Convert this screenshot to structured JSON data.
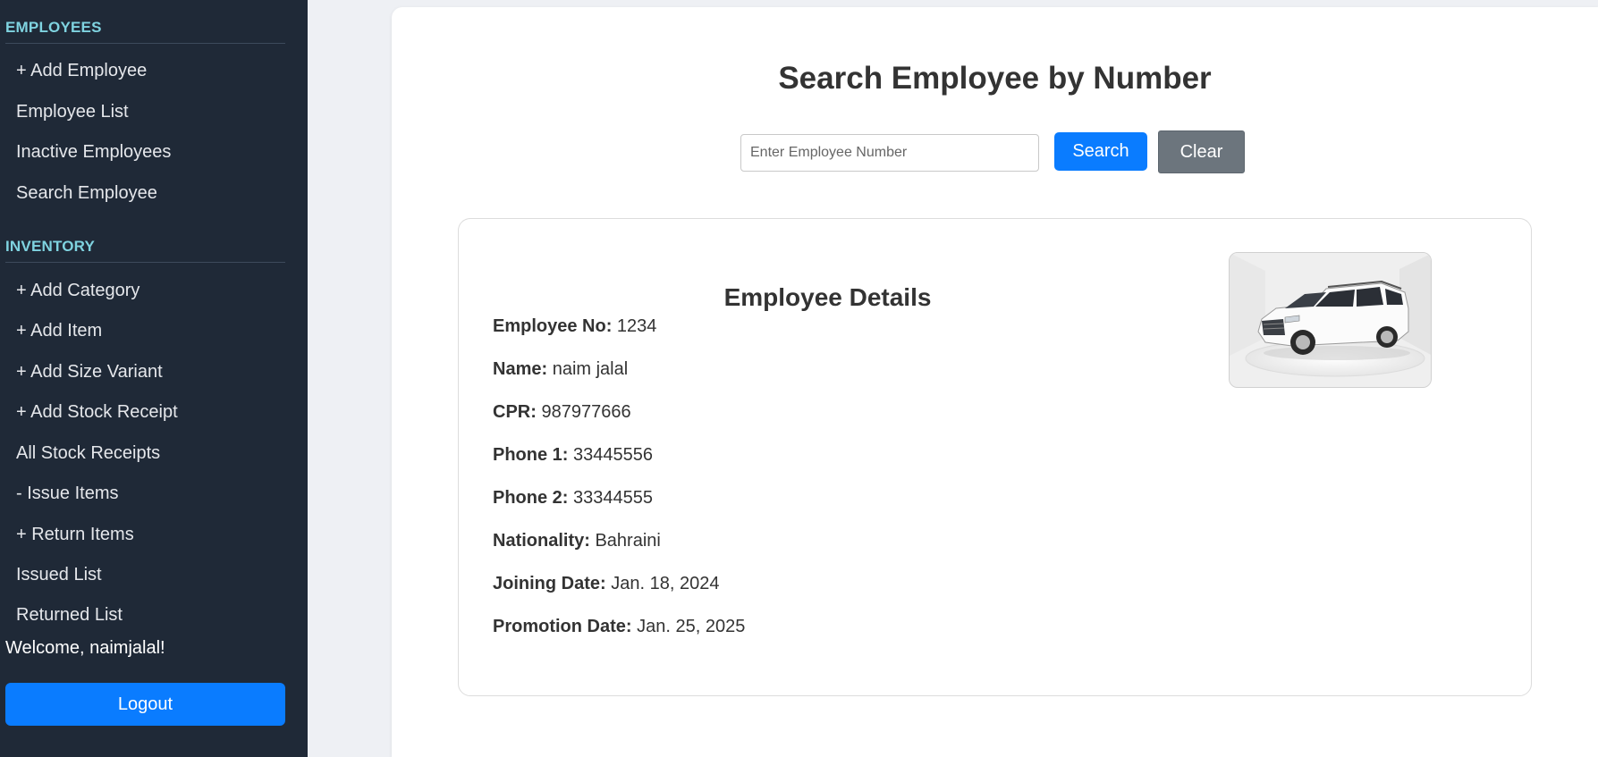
{
  "sidebar": {
    "employees_title": "EMPLOYEES",
    "employees_items": [
      {
        "label": "+ Add Employee"
      },
      {
        "label": "Employee List"
      },
      {
        "label": "Inactive Employees"
      },
      {
        "label": "Search Employee"
      }
    ],
    "inventory_title": "INVENTORY",
    "inventory_items": [
      {
        "label": "+ Add Category"
      },
      {
        "label": "+ Add Item"
      },
      {
        "label": "+ Add Size Variant"
      },
      {
        "label": "+ Add Stock Receipt"
      },
      {
        "label": "All Stock Receipts"
      },
      {
        "label": "- Issue Items"
      },
      {
        "label": "+ Return Items"
      },
      {
        "label": "Issued List"
      },
      {
        "label": "Returned List"
      }
    ],
    "welcome": "Welcome, naimjalal!",
    "logout_label": "Logout"
  },
  "main": {
    "title": "Search Employee by Number",
    "search_placeholder": "Enter Employee Number",
    "search_value": "",
    "search_label": "Search",
    "clear_label": "Clear",
    "details": {
      "title": "Employee Details",
      "rows": [
        {
          "label": "Employee No:",
          "value": "1234"
        },
        {
          "label": "Name:",
          "value": "naim jalal"
        },
        {
          "label": "CPR:",
          "value": "987977666"
        },
        {
          "label": "Phone 1:",
          "value": "33445556"
        },
        {
          "label": "Phone 2:",
          "value": "33344555"
        },
        {
          "label": "Nationality:",
          "value": "Bahraini"
        },
        {
          "label": "Joining Date:",
          "value": "Jan. 18, 2024"
        },
        {
          "label": "Promotion Date:",
          "value": "Jan. 25, 2025"
        }
      ],
      "photo_subject": "white-suv-photo"
    }
  },
  "colors": {
    "sidebar_bg": "#1f2937",
    "section_accent": "#7fd3e0",
    "primary_button": "#0a7cff",
    "secondary_button": "#6c757d",
    "page_bg": "#eef0f4"
  }
}
